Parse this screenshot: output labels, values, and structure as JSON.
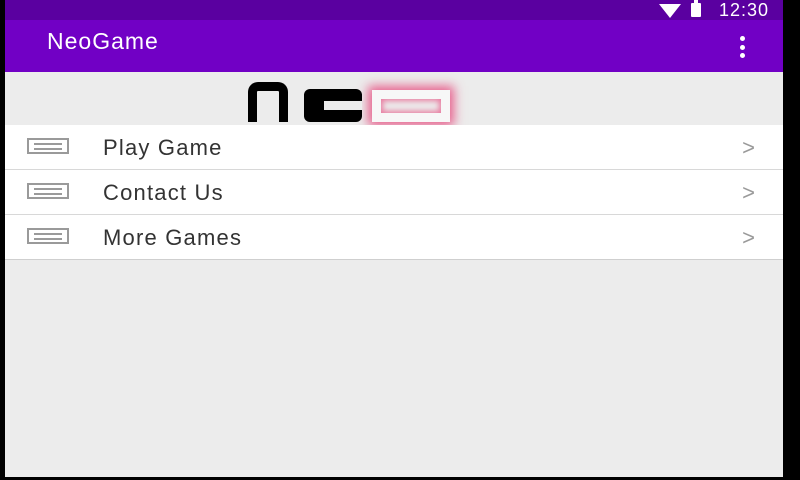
{
  "status_bar": {
    "time": "12:30",
    "icons": [
      "wifi-icon",
      "battery-icon"
    ]
  },
  "app_bar": {
    "title": "NeoGame",
    "overflow_icon": "more-vert-icon"
  },
  "logo": {
    "text": "Neo"
  },
  "menu": {
    "items": [
      {
        "label": "Play Game",
        "icon": "list-icon",
        "chevron": ">"
      },
      {
        "label": "Contact Us",
        "icon": "list-icon",
        "chevron": ">"
      },
      {
        "label": "More Games",
        "icon": "list-icon",
        "chevron": ">"
      }
    ]
  },
  "colors": {
    "status_bar": "#5a00a0",
    "app_bar": "#7100c5",
    "background": "#ececec",
    "logo_glow": "#e6326e"
  }
}
